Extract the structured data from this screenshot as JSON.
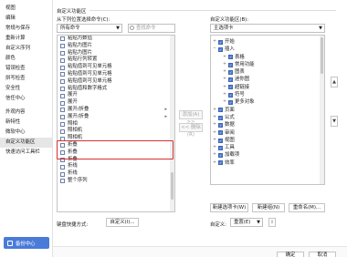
{
  "nav": {
    "items": [
      "视图",
      "编辑",
      "常规与保存",
      "重新计算",
      "自定义序列",
      "颜色",
      "错误检查",
      "拼写检查",
      "安全性",
      "信任中心",
      "外观内容",
      "新特性",
      "微软中心",
      "自定义功能区",
      "快速访问工具栏"
    ],
    "selected_index": 13,
    "backup_label": "备份中心"
  },
  "header": {
    "section_title": "自定义功能区",
    "from_label": "从下列位置选择命令(C):",
    "from_value": "所有命令",
    "search_placeholder": "查找命令",
    "right_label": "自定义功能区(B):",
    "right_value": "主选项卡"
  },
  "commands": [
    {
      "label": "粘贴为数值",
      "icon": "paste-icon"
    },
    {
      "label": "粘贴为图片",
      "icon": "paste-icon"
    },
    {
      "label": "粘贴为图片",
      "icon": "paste-icon"
    },
    {
      "label": "粘贴行列转置",
      "icon": "paste-icon"
    },
    {
      "label": "粘贴值到可见单元格",
      "icon": "paste-icon"
    },
    {
      "label": "粘贴值到可见单元格",
      "icon": "paste-icon"
    },
    {
      "label": "粘贴值到可见单元格",
      "icon": "paste-icon"
    },
    {
      "label": "粘贴值和数字格式",
      "icon": "paste-icon"
    },
    {
      "label": "展开",
      "icon": "expand-icon"
    },
    {
      "label": "展开",
      "icon": "expand-icon"
    },
    {
      "label": "展开/折叠",
      "icon": "expand-collapse-icon"
    },
    {
      "label": "展开/折叠",
      "icon": "expand-collapse-icon"
    },
    {
      "label": "照相",
      "icon": "camera-icon"
    },
    {
      "label": "照相机",
      "icon": "camera-icon"
    },
    {
      "label": "照相机",
      "icon": "camera-icon"
    },
    {
      "label": "折叠",
      "icon": "collapse-icon"
    },
    {
      "label": "折叠",
      "icon": "collapse-icon"
    },
    {
      "label": "折叠",
      "icon": "collapse-icon"
    },
    {
      "label": "折线",
      "icon": "line-icon"
    },
    {
      "label": "折线",
      "icon": "line-icon"
    },
    {
      "label": "整个序列",
      "icon": "series-icon"
    }
  ],
  "middle": {
    "add_label": "添加(A) >>",
    "remove_label": "<< 删除(R)"
  },
  "tree": [
    {
      "label": "开始",
      "toggle": "+",
      "depth": 1
    },
    {
      "label": "插入",
      "toggle": "−",
      "depth": 1
    },
    {
      "label": "表格",
      "toggle": "+",
      "depth": 2
    },
    {
      "label": "常用功能",
      "toggle": "+",
      "depth": 2
    },
    {
      "label": "图表",
      "toggle": "+",
      "depth": 2
    },
    {
      "label": "迷你图",
      "toggle": "+",
      "depth": 2
    },
    {
      "label": "超链接",
      "toggle": "+",
      "depth": 2
    },
    {
      "label": "符号",
      "toggle": "+",
      "depth": 2
    },
    {
      "label": "更多对象",
      "toggle": "+",
      "depth": 2
    },
    {
      "label": "页面",
      "toggle": "+",
      "depth": 1
    },
    {
      "label": "公式",
      "toggle": "+",
      "depth": 1
    },
    {
      "label": "数据",
      "toggle": "+",
      "depth": 1
    },
    {
      "label": "审阅",
      "toggle": "+",
      "depth": 1
    },
    {
      "label": "视图",
      "toggle": "+",
      "depth": 1
    },
    {
      "label": "工具",
      "toggle": "+",
      "depth": 1
    },
    {
      "label": "加载项",
      "toggle": "+",
      "depth": 1
    },
    {
      "label": "效率",
      "toggle": "+",
      "depth": 1
    }
  ],
  "buttons": {
    "new_tab": "新建选项卡(W)",
    "new_group": "新建组(N)",
    "rename": "重命名(M)...",
    "keyboard_label": "键盘快捷方式:",
    "customize": "自定义(I)...",
    "custom_label": "自定义:",
    "reset": "重置(E)",
    "ok": "确定",
    "cancel": "取消"
  },
  "colors": {
    "accent": "#4a7bd8",
    "highlight_border": "#d63030"
  }
}
